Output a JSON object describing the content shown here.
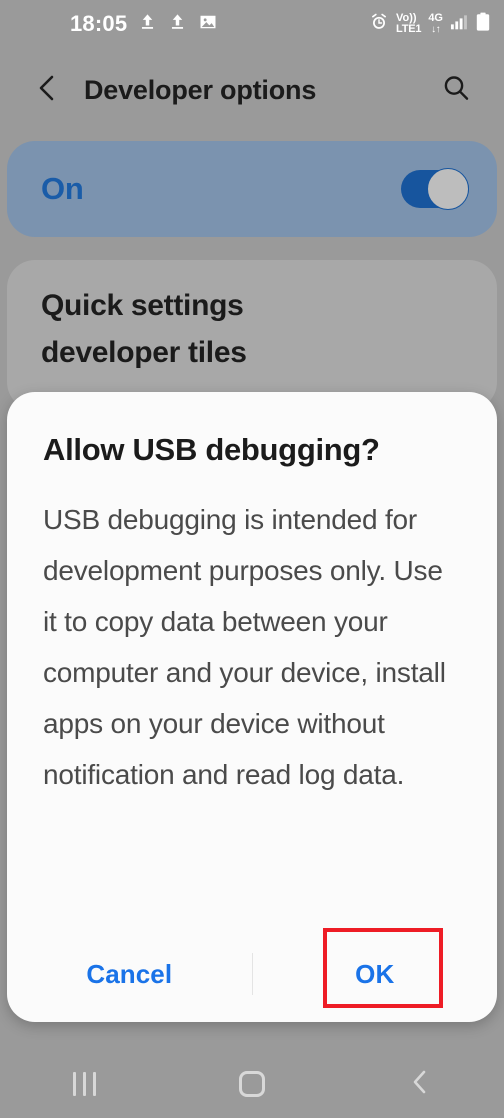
{
  "status_bar": {
    "time": "18:05",
    "left_icons": [
      "upload-icon",
      "upload-icon",
      "image-icon"
    ],
    "alarm_icon": "alarm-icon",
    "volte_line1": "Vo))",
    "volte_line2": "LTE1",
    "network_type": "4G",
    "data_arrows": "↓↑",
    "signal_icon": "signal-bars-icon",
    "battery_icon": "battery-icon"
  },
  "app_bar": {
    "back_icon": "chevron-left-icon",
    "title": "Developer options",
    "search_icon": "search-icon"
  },
  "settings": {
    "master_switch": {
      "label": "On",
      "state": "on"
    },
    "quick_settings": {
      "title_line1": "Quick settings",
      "title_line2": "developer tiles"
    }
  },
  "dialog": {
    "title": "Allow USB debugging?",
    "message": "USB debugging is intended for development purposes only. Use it to copy data between your computer and your device, install apps on your device without notification and read log data.",
    "cancel_label": "Cancel",
    "ok_label": "OK",
    "highlight_color": "#ee1c25",
    "accent_color": "#1a73e8"
  },
  "nav_bar": {
    "recents_icon": "recents-icon",
    "home_icon": "home-icon",
    "back_icon": "back-chevron-icon"
  }
}
